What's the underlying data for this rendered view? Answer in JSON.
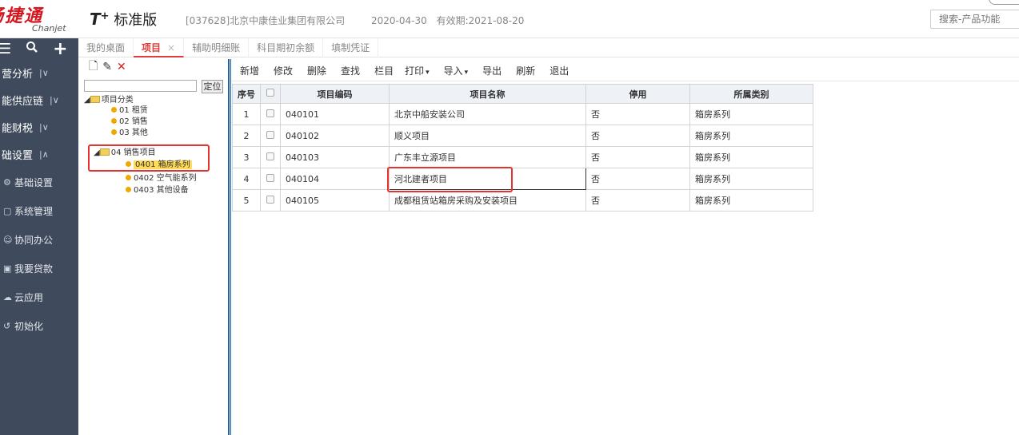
{
  "header": {
    "logo_cn": "畅捷通",
    "logo_en": "Chanjet",
    "product_mark": "T",
    "product_plus": "+",
    "product_name": "标准版",
    "company": "[037628]北京中康佳业集团有限公司",
    "date": "2020-04-30",
    "validity": "有效期:2021-08-20",
    "search_placeholder": "搜索-产品功能"
  },
  "sidebar": {
    "sections": [
      {
        "label": "营分析",
        "chevron": "|∨"
      },
      {
        "label": "能供应链",
        "chevron": "|∨"
      },
      {
        "label": "能财税",
        "chevron": "|∨"
      },
      {
        "label": "础设置",
        "chevron": "|∧"
      }
    ],
    "items": [
      {
        "icon": "gear-icon",
        "label": "基础设置"
      },
      {
        "icon": "folder-icon",
        "label": "系统管理"
      },
      {
        "icon": "people-icon",
        "label": "协同办公"
      },
      {
        "icon": "loan-icon",
        "label": "我要贷款"
      },
      {
        "icon": "cloud-icon",
        "label": "云应用"
      },
      {
        "icon": "init-icon",
        "label": "初始化"
      }
    ]
  },
  "tabs": [
    {
      "label": "我的桌面",
      "active": false
    },
    {
      "label": "项目",
      "active": true
    },
    {
      "label": "辅助明细账",
      "active": false
    },
    {
      "label": "科目期初余额",
      "active": false
    },
    {
      "label": "填制凭证",
      "active": false
    }
  ],
  "tree": {
    "locate_label": "定位",
    "nodes": {
      "root": "项目分类",
      "n01": "01 租赁",
      "n02": "02 销售",
      "n03": "03 其他",
      "n04": "04 销售项目",
      "n0401": "0401 箱房系列",
      "n0402": "0402 空气能系列",
      "n0403": "0403 其他设备"
    }
  },
  "toolbar": [
    "新增",
    "修改",
    "删除",
    "查找",
    "栏目",
    "打印",
    "导入",
    "导出",
    "刷新",
    "退出"
  ],
  "grid": {
    "columns": [
      "序号",
      "",
      "项目编码",
      "项目名称",
      "停用",
      "所属类别"
    ],
    "rows": [
      {
        "no": "1",
        "code": "040101",
        "name": "北京中船安装公司",
        "disabled": "否",
        "category": "箱房系列"
      },
      {
        "no": "2",
        "code": "040102",
        "name": "顺义项目",
        "disabled": "否",
        "category": "箱房系列"
      },
      {
        "no": "3",
        "code": "040103",
        "name": "广东丰立源项目",
        "disabled": "否",
        "category": "箱房系列"
      },
      {
        "no": "4",
        "code": "040104",
        "name": "河北建者项目",
        "disabled": "否",
        "category": "箱房系列"
      },
      {
        "no": "5",
        "code": "040105",
        "name": "成都租赁站箱房采购及安装项目",
        "disabled": "否",
        "category": "箱房系列"
      }
    ]
  }
}
